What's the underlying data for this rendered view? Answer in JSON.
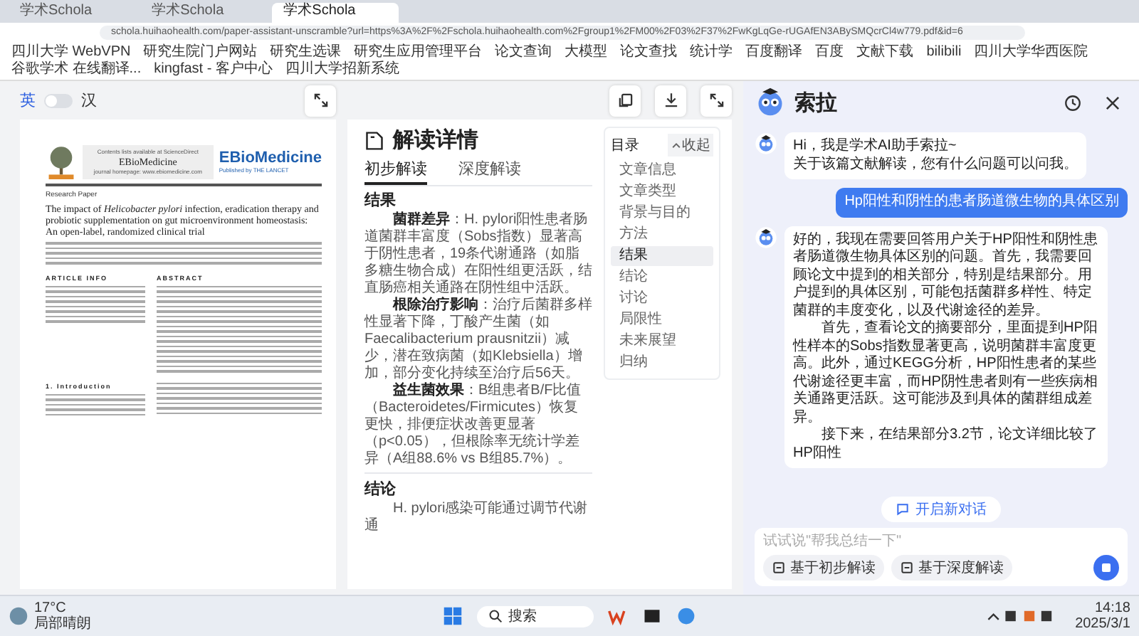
{
  "browser": {
    "tabs": [
      {
        "label": "学术Schola",
        "selected": false
      },
      {
        "label": "学术Schola",
        "selected": false
      },
      {
        "label": "学术Schola",
        "selected": true
      }
    ],
    "url": "schola.huihaohealth.com/paper-assistant-unscramble?url=https%3A%2F%2Fschola.huihaohealth.com%2Fgroup1%2FM00%2F03%2F37%2FwKgLqGe-rUGAfEN3ABySMQcrCl4w779.pdf&id=6",
    "bookmarks": [
      "四川大学 WebVPN",
      "研究生院门户网站",
      "研究生选课",
      "研究生应用管理平台",
      "论文查询",
      "大模型",
      "论文查找",
      "统计学",
      "百度翻译",
      "百度",
      "文献下载",
      "bilibili",
      "四川大学华西医院",
      "谷歌学术 在线翻译...",
      "kingfast - 客户中心",
      "四川大学招新系统"
    ]
  },
  "language": {
    "left": "英",
    "right": "汉",
    "on": false
  },
  "paper": {
    "journal_note": "Contents lists available at ScienceDirect",
    "journal": "EBioMedicine",
    "homepage": "journal homepage: www.ebiomedicine.com",
    "brand": "EBioMedicine",
    "brand_sub": "Published by THE LANCET",
    "section": "Research Paper",
    "title": "The impact of *Helicobacter pylori* infection, eradication therapy and probiotic supplementation on gut microenvironment homeostasis: An open-label, randomized clinical trial",
    "info_heading": "ARTICLE INFO",
    "abstract_heading": "ABSTRACT",
    "intro_heading": "1. Introduction"
  },
  "reading": {
    "title": "解读详情",
    "tabs": [
      {
        "label": "初步解读",
        "selected": true
      },
      {
        "label": "深度解读",
        "selected": false
      }
    ],
    "sections": [
      {
        "heading": "结果",
        "paragraphs": [
          "**菌群差异**：H. pylori阳性患者肠道菌群丰富度（Sobs指数）显著高于阴性患者，19条代谢通路（如脂多糖生物合成）在阳性组更活跃，结直肠癌相关通路在阴性组中活跃。",
          "**根除治疗影响**：治疗后菌群多样性显著下降，丁酸产生菌（如Faecalibacterium prausnitzii）减少，潜在致病菌（如Klebsiella）增加，部分变化持续至治疗后56天。",
          "**益生菌效果**：B组患者B/F比值（Bacteroidetes/Firmicutes）恢复更快，排便症状改善更显著（p<0.05），但根除率无统计学差异（A组88.6% vs B组85.7%）。"
        ]
      },
      {
        "heading": "结论",
        "paragraphs": [
          "H. pylori感染可能通过调节代谢通"
        ]
      }
    ],
    "toc": {
      "title": "目录",
      "collapse": "收起",
      "items": [
        {
          "label": "文章信息",
          "selected": false
        },
        {
          "label": "文章类型",
          "selected": false
        },
        {
          "label": "背景与目的",
          "selected": false
        },
        {
          "label": "方法",
          "selected": false
        },
        {
          "label": "结果",
          "selected": true
        },
        {
          "label": "结论",
          "selected": false
        },
        {
          "label": "讨论",
          "selected": false
        },
        {
          "label": "局限性",
          "selected": false
        },
        {
          "label": "未来展望",
          "selected": false
        },
        {
          "label": "归纳",
          "selected": false
        }
      ]
    }
  },
  "assistant": {
    "name": "索拉",
    "messages": [
      {
        "kind": "bot",
        "paragraphs": [
          "Hi，我是学术AI助手索拉~\n关于该篇文献解读，您有什么问题可以问我。"
        ]
      },
      {
        "kind": "user",
        "paragraphs": [
          "Hp阳性和阴性的患者肠道微生物的具体区别"
        ]
      },
      {
        "kind": "bot",
        "paragraphs": [
          "好的，我现在需要回答用户关于HP阳性和阴性患者肠道微生物具体区别的问题。首先，我需要回顾论文中提到的相关部分，特别是结果部分。用户提到的具体区别，可能包括菌群多样性、特定菌群的丰度变化，以及代谢途径的差异。",
          "首先，查看论文的摘要部分，里面提到HP阳性样本的Sobs指数显著更高，说明菌群丰富度更高。此外，通过KEGG分析，HP阳性患者的某些代谢途径更丰富，而HP阴性患者则有一些疾病相关通路更活跃。这可能涉及到具体的菌群组成差异。",
          "接下来，在结果部分3.2节，论文详细比较了HP阳性"
        ]
      }
    ],
    "new_chat": "开启新对话",
    "placeholder": "试试说\"帮我总结一下\"",
    "chips": [
      "基于初步解读",
      "基于深度解读"
    ]
  },
  "taskbar": {
    "temperature": "17°C",
    "weather": "局部晴朗",
    "search": "搜索",
    "time": "14:18",
    "date": "2025/3/1"
  }
}
